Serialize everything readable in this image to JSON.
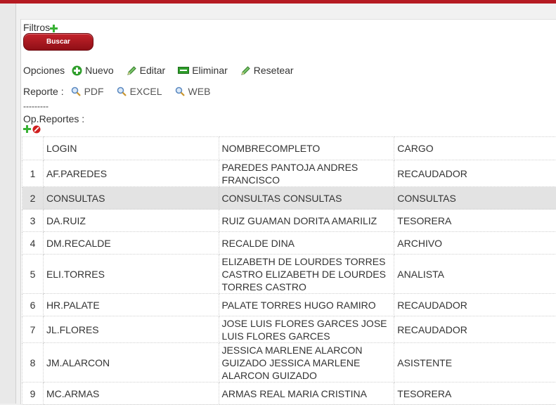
{
  "filters": {
    "label": "Filtros",
    "search_button": "Buscar"
  },
  "options": {
    "label": "Opciones",
    "items": [
      {
        "label": "Nuevo",
        "icon": "plus-icon"
      },
      {
        "label": "Editar",
        "icon": "pencil-icon"
      },
      {
        "label": "Eliminar",
        "icon": "minus-icon"
      },
      {
        "label": "Resetear",
        "icon": "pencil-icon"
      }
    ]
  },
  "reports": {
    "label": "Reporte :",
    "items": [
      {
        "label": "PDF",
        "icon": "magnifier-icon"
      },
      {
        "label": "EXCEL",
        "icon": "magnifier-icon"
      },
      {
        "label": "WEB",
        "icon": "magnifier-icon"
      }
    ]
  },
  "separator": "---------",
  "op_reports": {
    "label": "Op.Reportes :"
  },
  "table": {
    "columns": [
      "LOGIN",
      "NOMBRECOMPLETO",
      "CARGO"
    ],
    "rows": [
      {
        "n": "1",
        "login": "AF.PAREDES",
        "nombre": "PAREDES PANTOJA ANDRES FRANCISCO",
        "cargo": "RECAUDADOR"
      },
      {
        "n": "2",
        "login": "CONSULTAS",
        "nombre": "CONSULTAS CONSULTAS",
        "cargo": "CONSULTAS"
      },
      {
        "n": "3",
        "login": "DA.RUIZ",
        "nombre": "RUIZ GUAMAN DORITA AMARILIZ",
        "cargo": "TESORERA"
      },
      {
        "n": "4",
        "login": "DM.RECALDE",
        "nombre": "RECALDE DINA",
        "cargo": "ARCHIVO"
      },
      {
        "n": "5",
        "login": "ELI.TORRES",
        "nombre": "ELIZABETH DE LOURDES TORRES CASTRO ELIZABETH DE LOURDES TORRES CASTRO",
        "cargo": "ANALISTA"
      },
      {
        "n": "6",
        "login": "HR.PALATE",
        "nombre": "PALATE TORRES HUGO RAMIRO",
        "cargo": "RECAUDADOR"
      },
      {
        "n": "7",
        "login": "JL.FLORES",
        "nombre": "JOSE LUIS FLORES GARCES JOSE LUIS FLORES GARCES",
        "cargo": "RECAUDADOR"
      },
      {
        "n": "8",
        "login": "JM.ALARCON",
        "nombre": "JESSICA MARLENE ALARCON GUIZADO JESSICA MARLENE ALARCON GUIZADO",
        "cargo": "ASISTENTE"
      },
      {
        "n": "9",
        "login": "MC.ARMAS",
        "nombre": "ARMAS REAL MARIA CRISTINA",
        "cargo": "TESORERA"
      }
    ]
  }
}
